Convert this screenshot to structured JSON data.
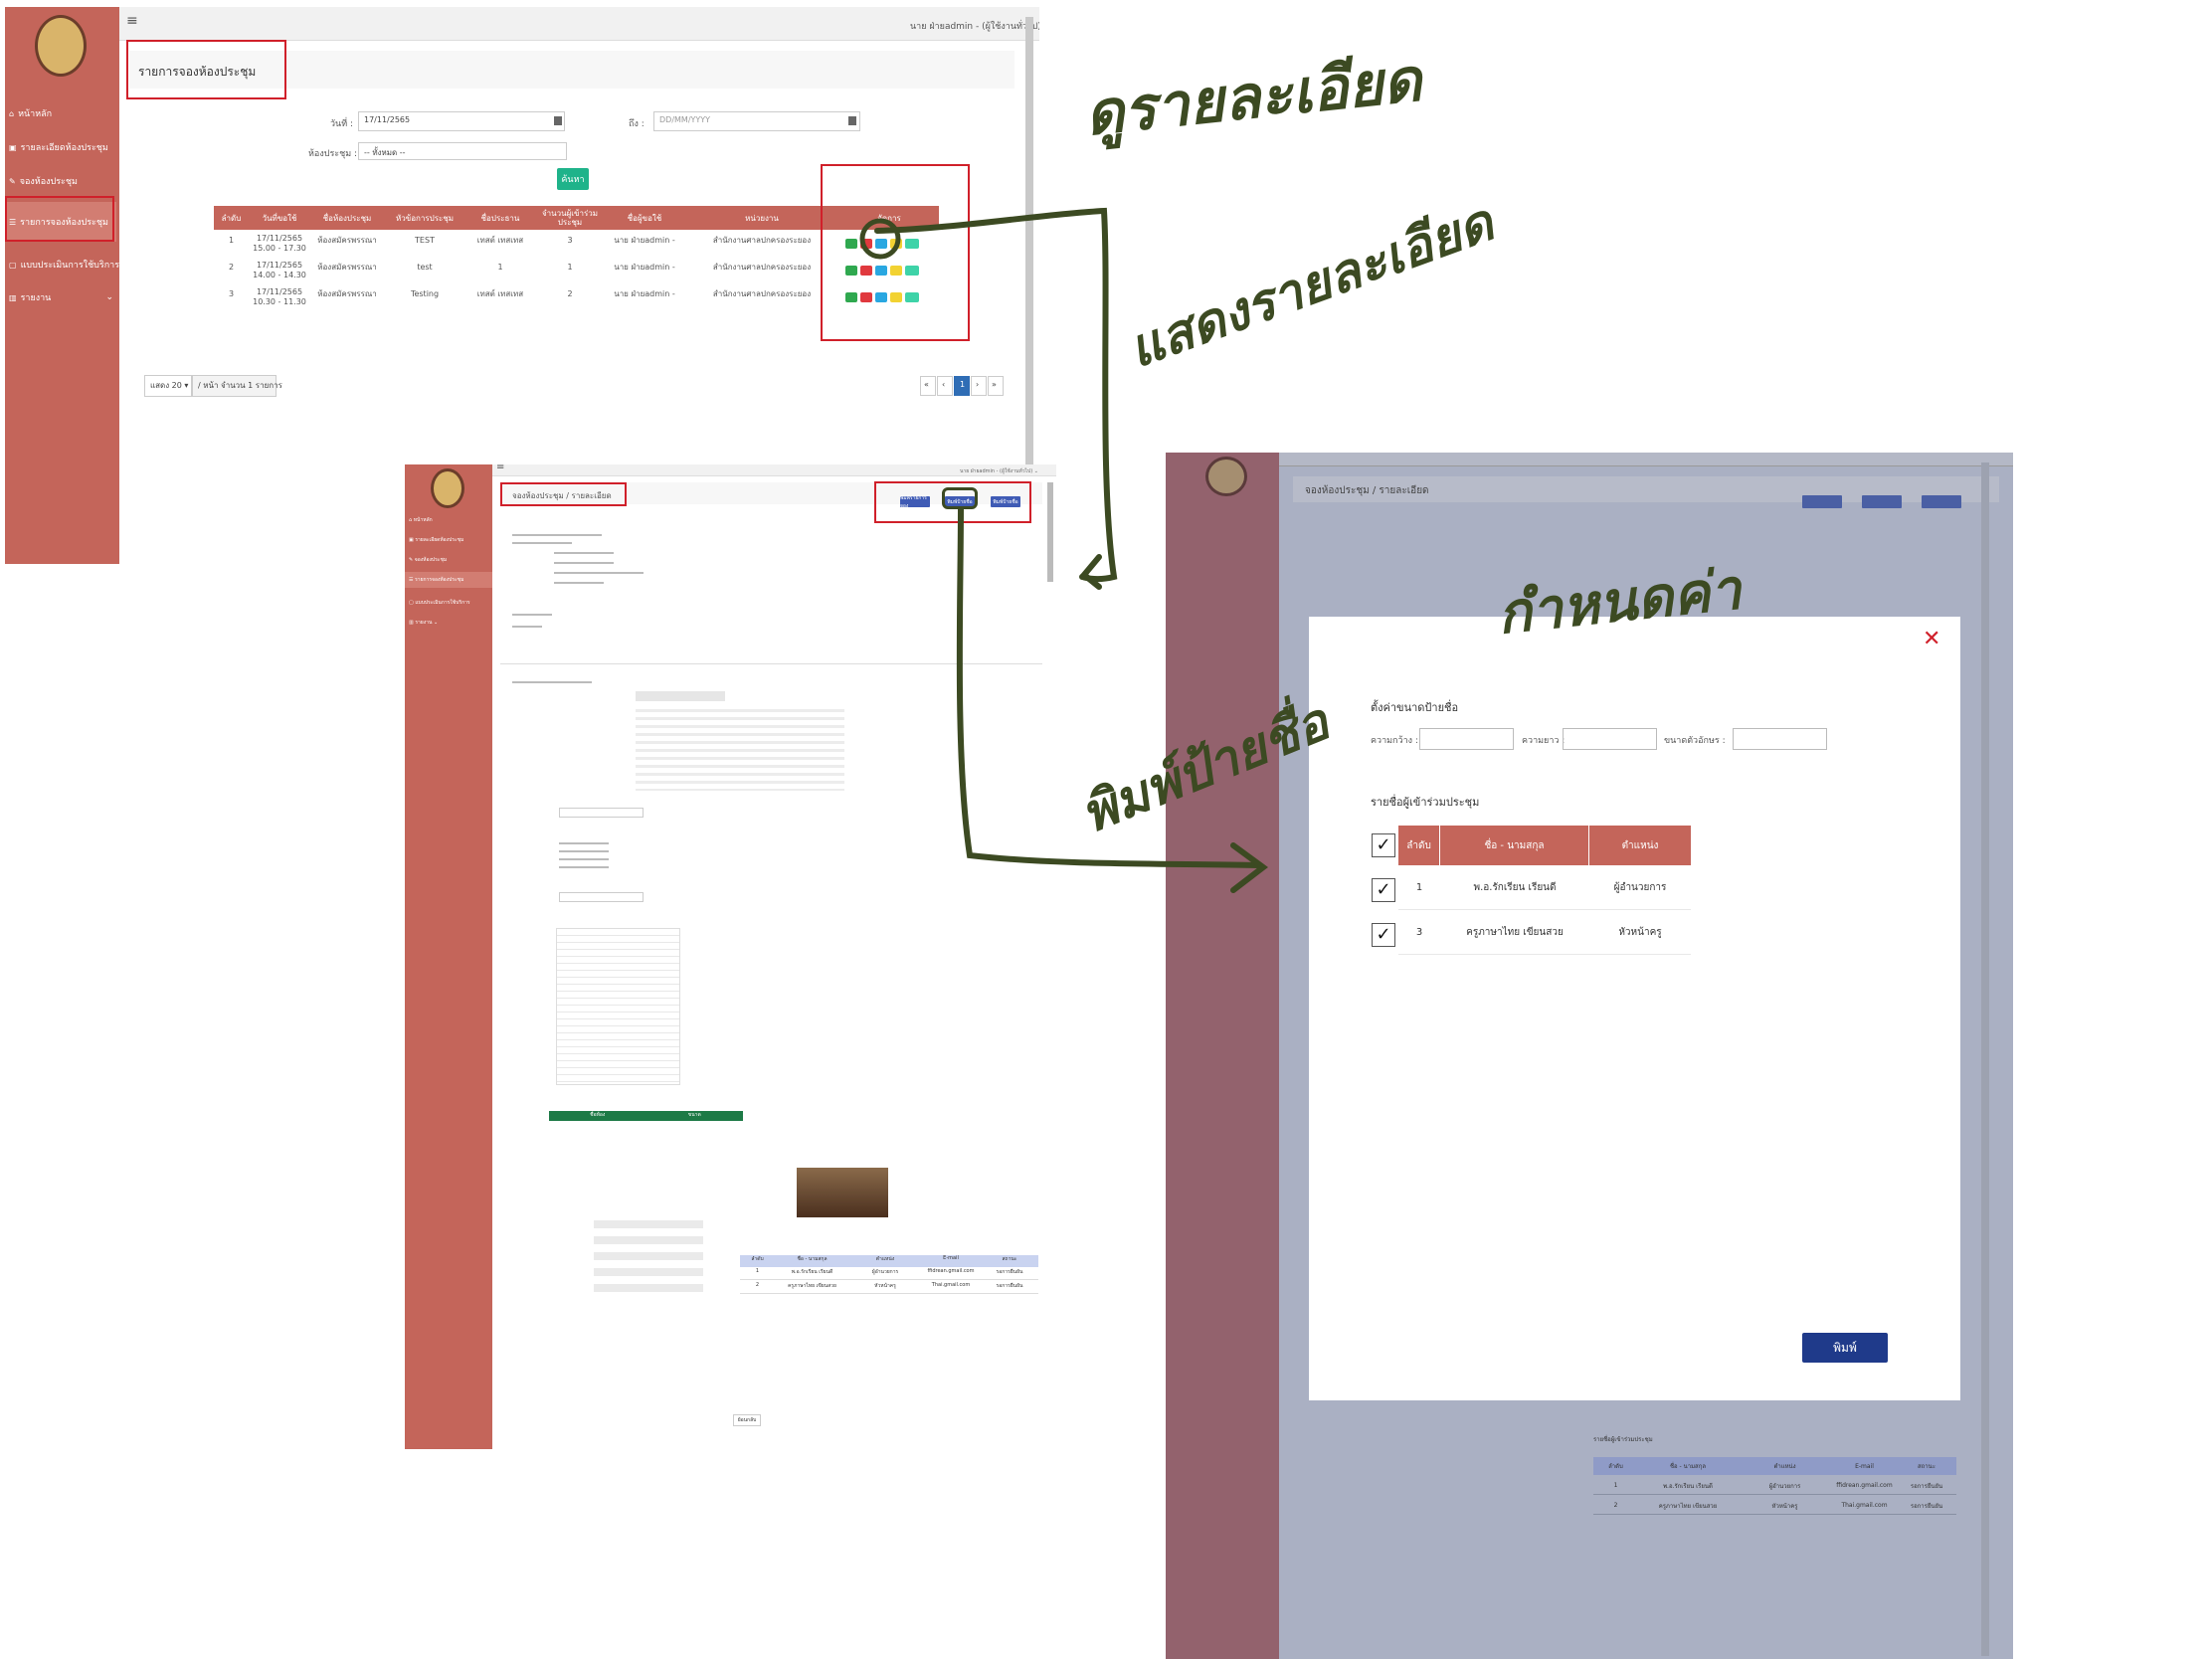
{
  "annotations": {
    "detail_title": "ดูรายละเอียด",
    "show_detail": "แสดงรายละเอียด",
    "print_name": "พิมพ์ป้ายชื่อ",
    "configure": "กำหนดค่า"
  },
  "shot1": {
    "user": "นาย ฝ่ายadmin - (ผู้ใช้งานทั่วไป) ⌄",
    "sidebar": [
      "หน้าหลัก",
      "รายละเอียดห้องประชุม",
      "จองห้องประชุม",
      "รายการจองห้องประชุม",
      "แบบประเมินการใช้บริการ",
      "รายงาน"
    ],
    "title": "รายการจองห้องประชุม",
    "date_from_label": "วันที่ :",
    "date_from": "17/11/2565",
    "date_to_label": "ถึง :",
    "date_to_placeholder": "DD/MM/YYYY",
    "room_label": "ห้องประชุม :",
    "room_value": "-- ทั้งหมด --",
    "search": "ค้นหา",
    "headers": [
      "ลำดับ",
      "วันที่ขอใช้",
      "ชื่อห้องประชุม",
      "หัวข้อการประชุม",
      "ชื่อประธาน",
      "จำนวนผู้เข้าร่วมประชุม",
      "ชื่อผู้ขอใช้",
      "หน่วยงาน",
      "จัดการ"
    ],
    "rows": [
      {
        "no": "1",
        "date": "17/11/2565",
        "time": "15.00 - 17.30",
        "room": "ห้องสมัครพรรณา",
        "topic": "TEST",
        "chair": "เทสต์ เทสเทส",
        "count": "3",
        "user": "นาย ฝ่ายadmin -",
        "dept": "สำนักงานศาลปกครองระยอง"
      },
      {
        "no": "2",
        "date": "17/11/2565",
        "time": "14.00 - 14.30",
        "room": "ห้องสมัครพรรณา",
        "topic": "test",
        "chair": "1",
        "count": "1",
        "user": "นาย ฝ่ายadmin -",
        "dept": "สำนักงานศาลปกครองระยอง"
      },
      {
        "no": "3",
        "date": "17/11/2565",
        "time": "10.30 - 11.30",
        "room": "ห้องสมัครพรรณา",
        "topic": "Testing",
        "chair": "เทสต์ เทสเทส",
        "count": "2",
        "user": "นาย ฝ่ายadmin -",
        "dept": "สำนักงานศาลปกครองระยอง"
      }
    ],
    "show_label": "แสดง 20 ▾",
    "per_page": "/ หน้า จำนวน 1 รายการ",
    "pages": [
      "«",
      "‹",
      "1",
      "›",
      "»"
    ]
  },
  "shot2": {
    "user": "นาย ฝ่ายadmin - (ผู้ใช้งานทั่วไป) ⌄",
    "breadcrumb": "จองห้องประชุม  /  รายละเอียด",
    "buttons": [
      "พิมพ์รายการจอง",
      "พิมพ์ป้ายชื่อ",
      "พิมพ์ป้ายชื่อ"
    ],
    "room_table_headers": [
      "ชื่อห้อง",
      "ขนาด"
    ],
    "attendee_headers": [
      "ลำดับ",
      "ชื่อ - นามสกุล",
      "ตำแหน่ง",
      "E-mail",
      "สถานะ"
    ],
    "attendees": [
      {
        "no": "1",
        "name": "พ.อ.รักเรียน เรียนดี",
        "pos": "ผู้อำนวยการ",
        "email": "ffidrean.gmail.com",
        "status": "รอการยืนยัน"
      },
      {
        "no": "2",
        "name": "ครูภาษาไทย เขียนสวย",
        "pos": "หัวหน้าครู",
        "email": "Thai.gmail.com",
        "status": "รอการยืนยัน"
      }
    ],
    "back": "ย้อนกลับ"
  },
  "shot3": {
    "breadcrumb": "จองห้องประชุม  /  รายละเอียด",
    "modal": {
      "section1": "ตั้งค่าขนาดป้ายชื่อ",
      "width_label": "ความกว้าง :",
      "length_label": "ความยาว :",
      "font_label": "ขนาดตัวอักษร :",
      "section2": "รายชื่อผู้เข้าร่วมประชุม",
      "headers": [
        "ลำดับ",
        "ชื่อ - นามสกุล",
        "ตำแหน่ง"
      ],
      "rows": [
        {
          "no": "1",
          "name": "พ.อ.รักเรียน เรียนดี",
          "pos": "ผู้อำนวยการ"
        },
        {
          "no": "3",
          "name": "ครูภาษาไทย เขียนสวย",
          "pos": "หัวหน้าครู"
        }
      ],
      "print": "พิมพ์",
      "close": "✕"
    },
    "attendee_title": "รายชื่อผู้เข้าร่วมประชุม",
    "attendee_headers": [
      "ลำดับ",
      "ชื่อ - นามสกุล",
      "ตำแหน่ง",
      "E-mail",
      "สถานะ"
    ],
    "attendees": [
      {
        "no": "1",
        "name": "พ.อ.รักเรียน เรียนดี",
        "pos": "ผู้อำนวยการ",
        "email": "ffidrean.gmail.com",
        "status": "รอการยืนยัน"
      },
      {
        "no": "2",
        "name": "ครูภาษาไทย เขียนสวย",
        "pos": "หัวหน้าครู",
        "email": "Thai.gmail.com",
        "status": "รอการยืนยัน"
      }
    ]
  },
  "colors": {
    "sidebar": "#c4655a",
    "accent_blue": "#3f5bb5",
    "primary_navy": "#1f3a8a",
    "success": "#1fb38a",
    "annotation": "#3c4a22",
    "highlight": "#d0202a"
  }
}
